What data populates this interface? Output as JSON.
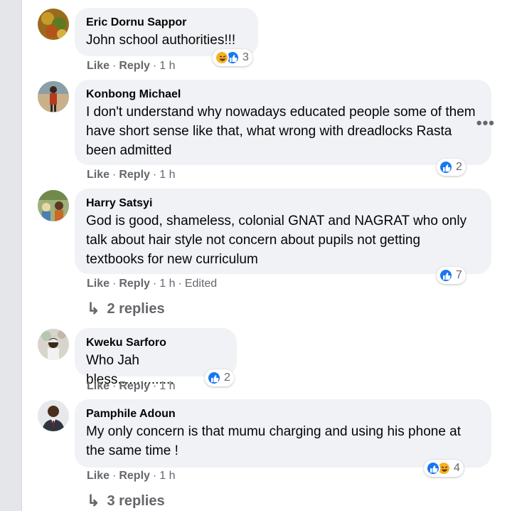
{
  "colors": {
    "accent": "#1877f2",
    "haha": "#f7b125",
    "bubble": "#f0f2f5",
    "meta": "#65676b"
  },
  "comments": [
    {
      "author": "Eric Dornu Sappor",
      "text": "John school authorities!!!",
      "reactions": {
        "icons": [
          "haha-icon",
          "like-icon"
        ],
        "count": "3"
      },
      "like": "Like",
      "reply": "Reply",
      "time": "1 h"
    },
    {
      "author": "Konbong Michael",
      "text": "I don't understand why nowadays educated people some of them have short sense like that, what wrong with dreadlocks Rasta been admitted",
      "reactions": {
        "icons": [
          "like-icon"
        ],
        "count": "2"
      },
      "like": "Like",
      "reply": "Reply",
      "time": "1 h",
      "more": "•••"
    },
    {
      "author": "Harry Satsyi",
      "text": "God is good, shameless, colonial GNAT and NAGRAT who only talk about hair style not concern about pupils not getting textbooks for new curriculum",
      "reactions": {
        "icons": [
          "like-icon"
        ],
        "count": "7"
      },
      "like": "Like",
      "reply": "Reply",
      "time": "1 h",
      "edited": "Edited",
      "replies": "2 replies"
    },
    {
      "author": "Kweku Sarforo",
      "text": "Who Jah bless...............",
      "reactions": {
        "icons": [
          "like-icon"
        ],
        "count": "2"
      },
      "like": "Like",
      "reply": "Reply",
      "time": "1 h"
    },
    {
      "author": "Pamphile Adoun",
      "text": "My only concern is that mumu charging and using his phone at the same time !",
      "reactions": {
        "icons": [
          "like-icon",
          "haha-icon"
        ],
        "count": "4"
      },
      "like": "Like",
      "reply": "Reply",
      "time": "1 h",
      "replies": "3 replies"
    }
  ]
}
